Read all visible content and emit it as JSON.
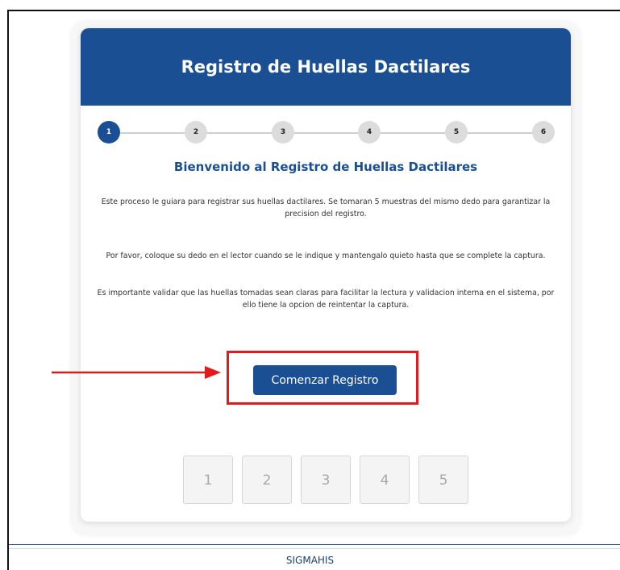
{
  "header": {
    "title": "Registro de Huellas Dactilares"
  },
  "stepper": {
    "steps": [
      "1",
      "2",
      "3",
      "4",
      "5",
      "6"
    ],
    "active_step": "1"
  },
  "content": {
    "welcome_title": "Bienvenido al Registro de Huellas Dactilares",
    "paragraph_1": "Este proceso le guiara para registrar sus huellas dactilares. Se tomaran 5 muestras del mismo dedo para garantizar la precision del registro.",
    "paragraph_2": "Por favor, coloque su dedo en el lector cuando se le indique y mantengalo quieto hasta que se complete la captura.",
    "paragraph_3": "Es importante validar que las huellas tomadas sean claras para facilitar la lectura y validacion interna en el sistema, por ello tiene la opcion de reintentar la captura.",
    "start_button_label": "Comenzar Registro"
  },
  "samples": {
    "slots": [
      "1",
      "2",
      "3",
      "4",
      "5"
    ]
  },
  "footer": {
    "text": "SIGMAHIS"
  },
  "colors": {
    "primary": "#1b4f93",
    "highlight": "#e11b1b",
    "step_inactive": "#dcdcdc"
  },
  "annotations": {
    "arrow_icon": "right-arrow-icon"
  }
}
